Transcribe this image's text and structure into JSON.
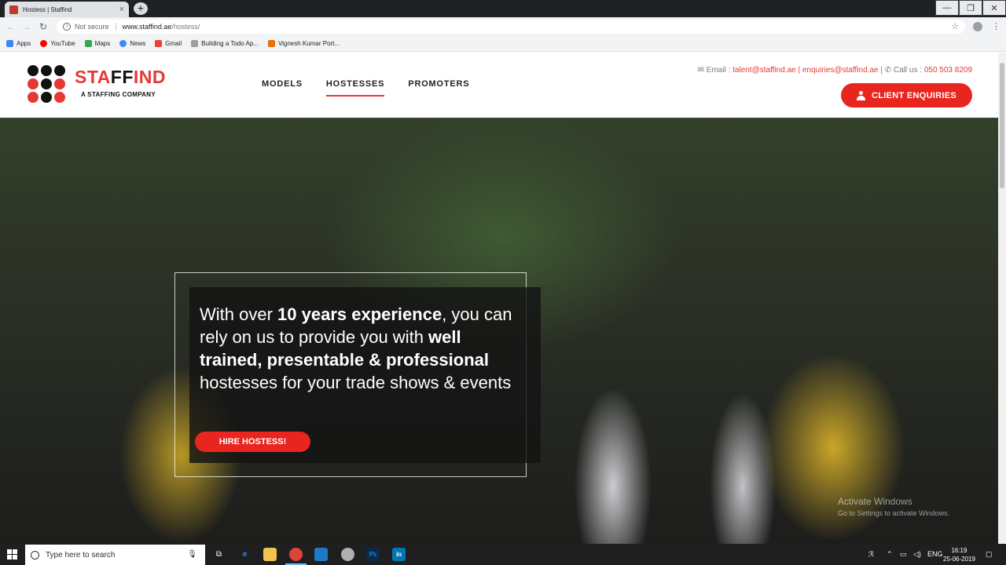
{
  "browser": {
    "tab_title": "Hostess | Staffind",
    "tab_close": "×",
    "new_tab": "+",
    "window_controls": {
      "minimize": "—",
      "maximize": "❐",
      "close": "✕"
    },
    "security_label": "Not secure",
    "url_host": "www.staffind.ae",
    "url_path": "/hostess/",
    "bookmarks": [
      "Apps",
      "YouTube",
      "Maps",
      "News",
      "Gmail",
      "Building a Todo Ap...",
      "Vignesh Kumar Port..."
    ]
  },
  "site": {
    "logo_main": "STA",
    "logo_ff": "FF",
    "logo_end": "IND",
    "logo_tagline": "A STAFFING COMPANY",
    "nav": [
      "MODELS",
      "HOSTESSES",
      "PROMOTERS"
    ],
    "active_nav": "HOSTESSES",
    "contact": {
      "email_label": "Email :",
      "email1": "talent@staffind.ae",
      "divider": "|",
      "email2": "enquiries@staffind.ae",
      "call_label": "Call us :",
      "phone": "050 503 8209"
    },
    "cta_label": "CLIENT ENQUIRIES"
  },
  "hero": {
    "text_1": "With over ",
    "text_2": "10 years experience",
    "text_3": ", you can rely on us to provide you with ",
    "text_4": "well trained, presentable & professional",
    "text_5": " hostesses for your trade shows & events",
    "button_label": "HIRE HOSTESS!"
  },
  "watermark": {
    "title": "Activate Windows",
    "subtitle": "Go to Settings to activate Windows."
  },
  "taskbar": {
    "search_placeholder": "Type here to search",
    "language": "ENG",
    "time": "16:19",
    "date": "25-06-2019"
  },
  "colors": {
    "brand_red": "#e53935",
    "brand_black": "#111111"
  }
}
